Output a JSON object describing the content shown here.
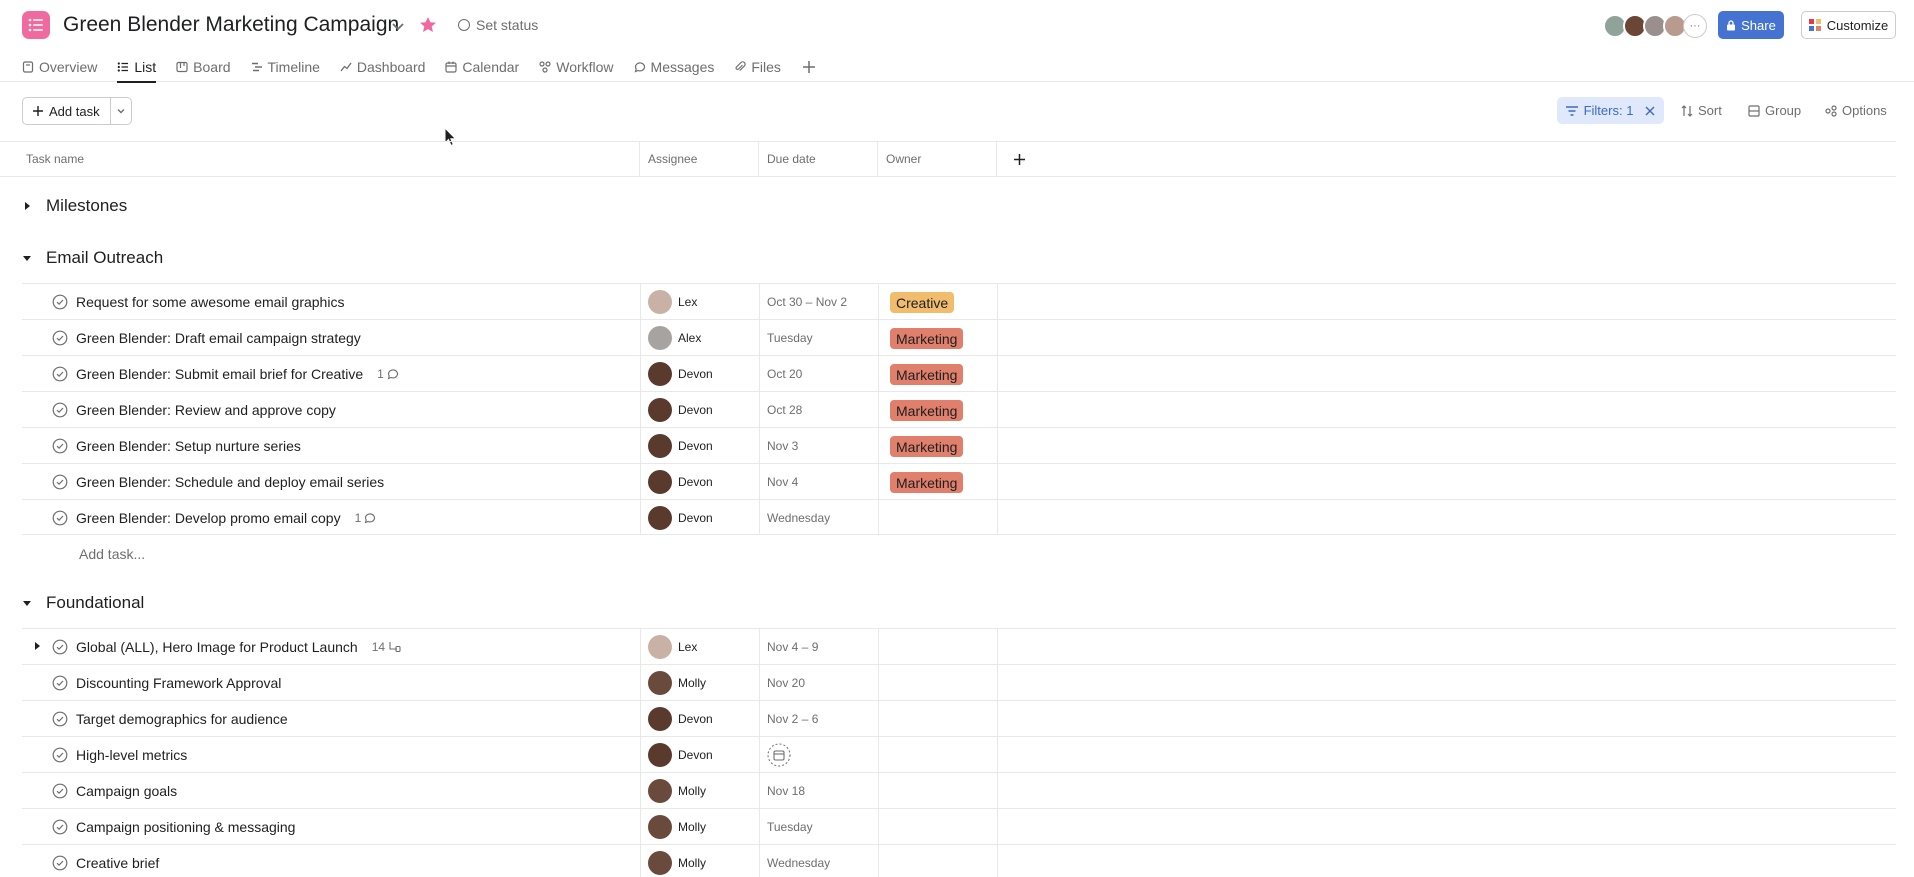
{
  "header": {
    "title": "Green Blender Marketing Campaign",
    "set_status": "Set status",
    "share_label": "Share",
    "customize_label": "Customize",
    "brand_color": "#f06a9f",
    "star_color": "#f06a9f"
  },
  "tabs": [
    {
      "label": "Overview",
      "icon": "overview-icon"
    },
    {
      "label": "List",
      "icon": "list-icon",
      "active": true
    },
    {
      "label": "Board",
      "icon": "board-icon"
    },
    {
      "label": "Timeline",
      "icon": "timeline-icon"
    },
    {
      "label": "Dashboard",
      "icon": "dashboard-icon"
    },
    {
      "label": "Calendar",
      "icon": "calendar-icon"
    },
    {
      "label": "Workflow",
      "icon": "workflow-icon"
    },
    {
      "label": "Messages",
      "icon": "messages-icon"
    },
    {
      "label": "Files",
      "icon": "files-icon"
    }
  ],
  "toolbar": {
    "add_task": "Add task",
    "filters": "Filters: 1",
    "sort": "Sort",
    "group": "Group",
    "options": "Options"
  },
  "columns": {
    "task_name": "Task name",
    "assignee": "Assignee",
    "due_date": "Due date",
    "owner": "Owner"
  },
  "sections": [
    {
      "name": "Milestones",
      "collapsed": true
    },
    {
      "name": "Email Outreach",
      "collapsed": false,
      "add_task": "Add task...",
      "rows": [
        {
          "task": "Request for some awesome email graphics",
          "assignee": "Lex",
          "due": "Oct 30 – Nov 2",
          "owner": "Creative",
          "owner_color": "#f1bd6c"
        },
        {
          "task": "Green Blender: Draft email campaign strategy",
          "assignee": "Alex",
          "due": "Tuesday",
          "owner": "Marketing",
          "owner_color": "#e07f6b"
        },
        {
          "task": "Green Blender: Submit email brief for Creative",
          "comments": "1",
          "assignee": "Devon",
          "due": "Oct 20",
          "owner": "Marketing",
          "owner_color": "#e07f6b"
        },
        {
          "task": "Green Blender: Review and approve copy",
          "assignee": "Devon",
          "due": "Oct 28",
          "owner": "Marketing",
          "owner_color": "#e07f6b"
        },
        {
          "task": "Green Blender: Setup nurture series",
          "assignee": "Devon",
          "due": "Nov 3",
          "owner": "Marketing",
          "owner_color": "#e07f6b"
        },
        {
          "task": "Green Blender: Schedule and deploy email series",
          "assignee": "Devon",
          "due": "Nov 4",
          "owner": "Marketing",
          "owner_color": "#e07f6b"
        },
        {
          "task": "Green Blender: Develop promo email copy",
          "comments": "1",
          "assignee": "Devon",
          "due": "Wednesday",
          "owner": ""
        }
      ]
    },
    {
      "name": "Foundational",
      "collapsed": false,
      "rows": [
        {
          "task": "Global (ALL), Hero Image for Product Launch",
          "subtasks": "14",
          "assignee": "Lex",
          "due": "Nov 4 – 9",
          "owner": ""
        },
        {
          "task": "Discounting Framework Approval",
          "assignee": "Molly",
          "due": "Nov 20",
          "owner": ""
        },
        {
          "task": "Target demographics for audience",
          "assignee": "Devon",
          "due": "Nov 2 – 6",
          "owner": ""
        },
        {
          "task": "High-level metrics",
          "assignee": "Devon",
          "due": "",
          "owner": ""
        },
        {
          "task": "Campaign goals",
          "assignee": "Molly",
          "due": "Nov 18",
          "owner": ""
        },
        {
          "task": "Campaign positioning & messaging",
          "assignee": "Molly",
          "due": "Tuesday",
          "owner": ""
        },
        {
          "task": "Creative brief",
          "assignee": "Molly",
          "due": "Wednesday",
          "owner": ""
        }
      ]
    }
  ]
}
